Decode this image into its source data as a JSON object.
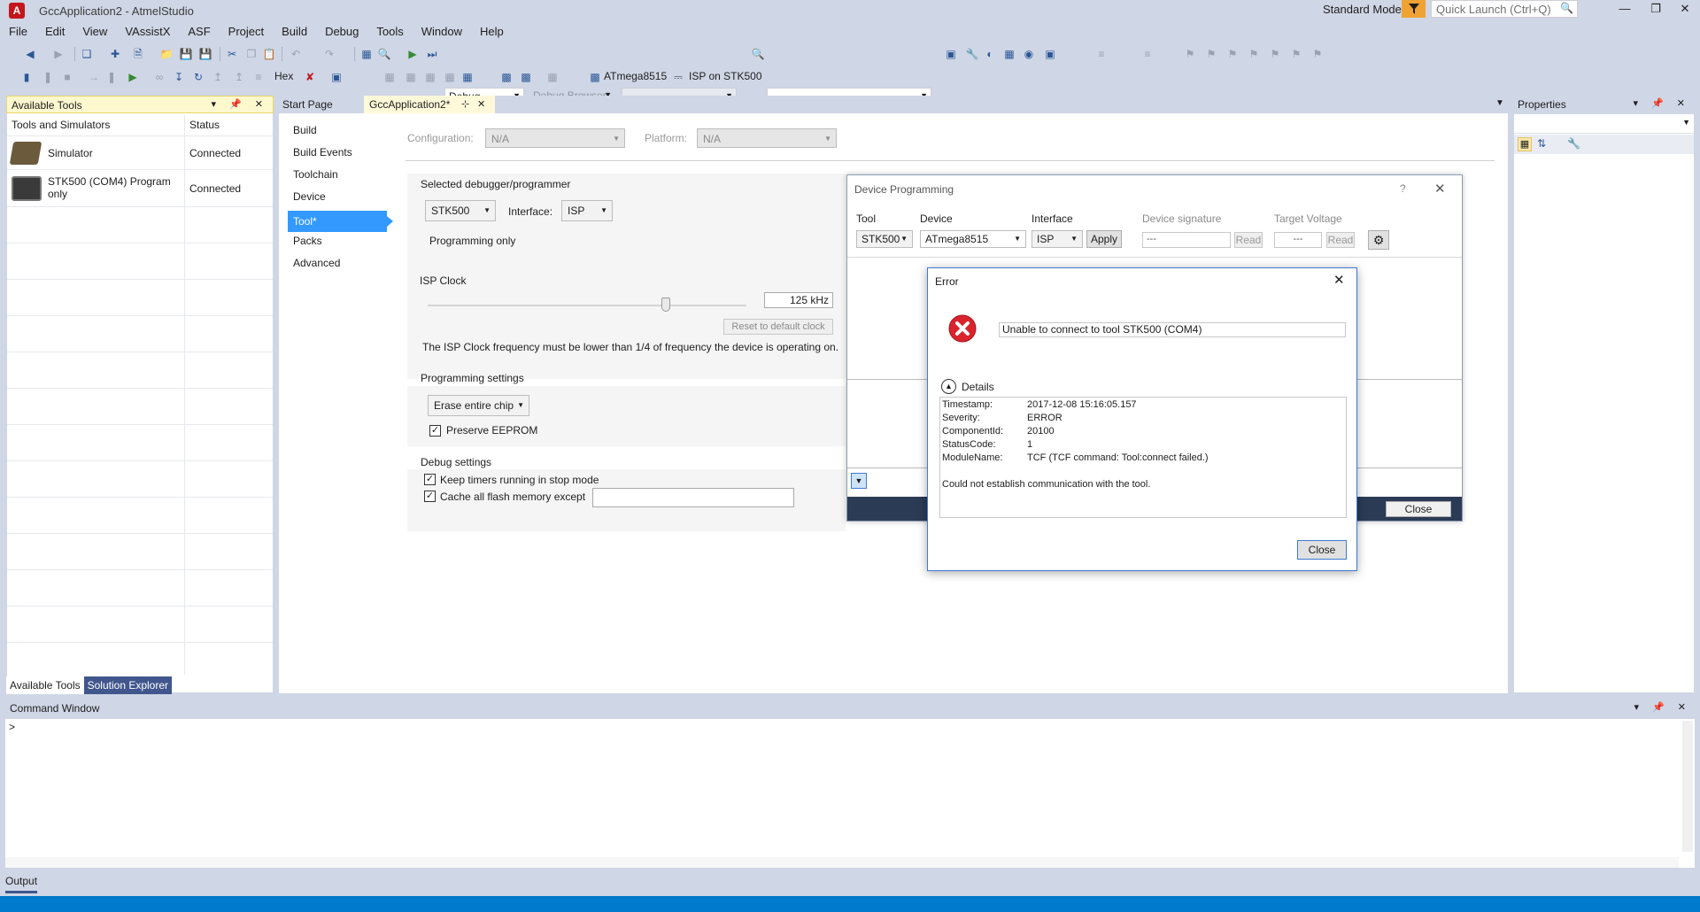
{
  "window": {
    "title": "GccApplication2 - AtmelStudio",
    "mode": "Standard Mode",
    "quick_launch_placeholder": "Quick Launch (Ctrl+Q)",
    "app_icon": "A"
  },
  "menu": [
    "File",
    "Edit",
    "View",
    "VAssistX",
    "ASF",
    "Project",
    "Build",
    "Debug",
    "Tools",
    "Window",
    "Help"
  ],
  "toolbar": {
    "config": "Debug",
    "debug_browser": "Debug Browser",
    "hex_label": "Hex",
    "device_label": "ATmega8515",
    "interface_label": "ISP on STK500"
  },
  "left_panel": {
    "title": "Available Tools",
    "col_tools": "Tools and Simulators",
    "col_status": "Status",
    "rows": [
      {
        "name": "Simulator",
        "status": "Connected"
      },
      {
        "name": "STK500 (COM4) Program only",
        "status": "Connected"
      }
    ],
    "tabs": [
      "Available Tools",
      "Solution Explorer"
    ]
  },
  "doc_tabs": [
    "Start Page",
    "GccApplication2*"
  ],
  "project": {
    "nav": [
      "Build",
      "Build Events",
      "Toolchain",
      "Device",
      "Tool*",
      "Packs",
      "Advanced"
    ],
    "configuration_label": "Configuration:",
    "configuration_value": "N/A",
    "platform_label": "Platform:",
    "platform_value": "N/A",
    "selected_debugger_label": "Selected debugger/programmer",
    "debugger_value": "STK500",
    "interface_label": "Interface:",
    "interface_value": "ISP",
    "programming_only": "Programming only",
    "isp_clock_label": "ISP Clock",
    "isp_clock_value": "125 kHz",
    "reset_clock": "Reset to default clock",
    "isp_note": "The ISP Clock frequency must be lower than 1/4 of frequency the device is operating on.",
    "programming_settings_label": "Programming settings",
    "erase_value": "Erase entire chip",
    "preserve_eeprom": "Preserve EEPROM",
    "debug_settings_label": "Debug settings",
    "keep_timers": "Keep timers running in stop mode",
    "cache_flash": "Cache all flash memory except"
  },
  "device_programming": {
    "title": "Device Programming",
    "tool_label": "Tool",
    "tool_value": "STK500",
    "device_label": "Device",
    "device_value": "ATmega8515",
    "interface_label": "Interface",
    "interface_value": "ISP",
    "apply": "Apply",
    "signature_label": "Device signature",
    "signature_value": "---",
    "read": "Read",
    "voltage_label": "Target Voltage",
    "voltage_value": "---",
    "close": "Close"
  },
  "error_dialog": {
    "title": "Error",
    "message": "Unable to connect to tool STK500 (COM4)",
    "details_label": "Details",
    "details": [
      {
        "k": "Timestamp:",
        "v": "2017-12-08 15:16:05.157"
      },
      {
        "k": "Severity:",
        "v": "ERROR"
      },
      {
        "k": "ComponentId:",
        "v": "20100"
      },
      {
        "k": "StatusCode:",
        "v": "1"
      },
      {
        "k": "ModuleName:",
        "v": "TCF (TCF command: Tool:connect failed.)"
      }
    ],
    "extra": "Could not establish communication with the tool.",
    "close": "Close"
  },
  "properties": {
    "title": "Properties"
  },
  "command_window": {
    "title": "Command Window",
    "prompt": ">"
  },
  "output": {
    "label": "Output"
  },
  "colors": {
    "accent": "#007acc",
    "selected_nav": "#3399ff",
    "error_red": "#d9232d",
    "panel_title": "#fef8cf"
  }
}
